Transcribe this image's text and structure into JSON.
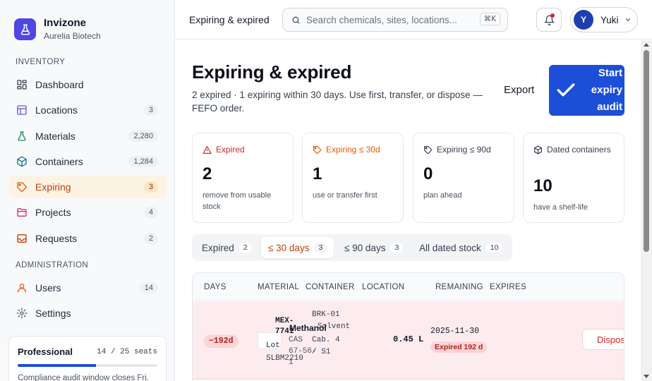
{
  "brand": {
    "name": "Invizone",
    "org": "Aurelia Biotech"
  },
  "sidebar": {
    "inventory_label": "INVENTORY",
    "admin_label": "ADMINISTRATION",
    "items": [
      {
        "label": "Dashboard",
        "icon": "dashboard-icon",
        "count": ""
      },
      {
        "label": "Locations",
        "icon": "locations-icon",
        "count": "3"
      },
      {
        "label": "Materials",
        "icon": "flask-icon",
        "count": "2,280"
      },
      {
        "label": "Containers",
        "icon": "box-icon",
        "count": "1,284"
      },
      {
        "label": "Expiring",
        "icon": "tag-icon",
        "count": "3"
      },
      {
        "label": "Projects",
        "icon": "folder-icon",
        "count": "4"
      },
      {
        "label": "Requests",
        "icon": "inbox-icon",
        "count": "2"
      }
    ],
    "admin_items": [
      {
        "label": "Users",
        "icon": "user-icon",
        "count": "14"
      },
      {
        "label": "Settings",
        "icon": "gear-icon",
        "count": ""
      }
    ],
    "plan": {
      "name": "Professional",
      "seats": "14 / 25 seats",
      "seats_fraction": 0.56,
      "note": "Compliance audit window closes Fri."
    }
  },
  "header": {
    "title": "Expiring & expired",
    "search_placeholder": "Search chemicals, sites, locations...",
    "shortcut": "⌘K",
    "user": {
      "initial": "Y",
      "name": "Yuki"
    }
  },
  "main": {
    "title": "Expiring & expired",
    "subtitle": "2 expired · 1 expiring within 30 days. Use first, transfer, or dispose — FEFO order.",
    "export_label": "Export",
    "audit_label": "Start expiry audit",
    "stats": [
      {
        "label": "Expired",
        "value": "2",
        "desc": "remove from usable stock",
        "color": "#dc2626",
        "icon": "alert-triangle-icon"
      },
      {
        "label": "Expiring ≤ 30d",
        "value": "1",
        "desc": "use or transfer first",
        "color": "#ea580c",
        "icon": "tag-icon"
      },
      {
        "label": "Expiring ≤ 90d",
        "value": "0",
        "desc": "plan ahead",
        "color": "#374151",
        "icon": "tag-icon"
      },
      {
        "label": "Dated containers",
        "value": "10",
        "desc": "have a shelf-life",
        "color": "#374151",
        "icon": "box-icon"
      }
    ],
    "tabs": [
      {
        "label": "Expired",
        "count": "2"
      },
      {
        "label": "≤ 30 days",
        "count": "3"
      },
      {
        "label": "≤ 90 days",
        "count": "3"
      },
      {
        "label": "All dated stock",
        "count": "10"
      }
    ],
    "table": {
      "columns": [
        "DAYS",
        "MATERIAL",
        "CONTAINER",
        "LOCATION",
        "REMAINING",
        "EXPIRES"
      ],
      "rows": [
        {
          "days": "−192d",
          "material_code": "MEX-7741",
          "material_name": "Methanol",
          "lot_label": "Lot",
          "cas": "CAS 67-56-1",
          "lot_no": "SLBM2210",
          "container": "BRK-01",
          "container_type": "Solvent",
          "location": "Cab. 4 / S1",
          "remaining": "0.45 L",
          "expires": "2025-11-30",
          "expired_badge": "Expired 192 d",
          "action": "Dispose"
        }
      ]
    }
  }
}
